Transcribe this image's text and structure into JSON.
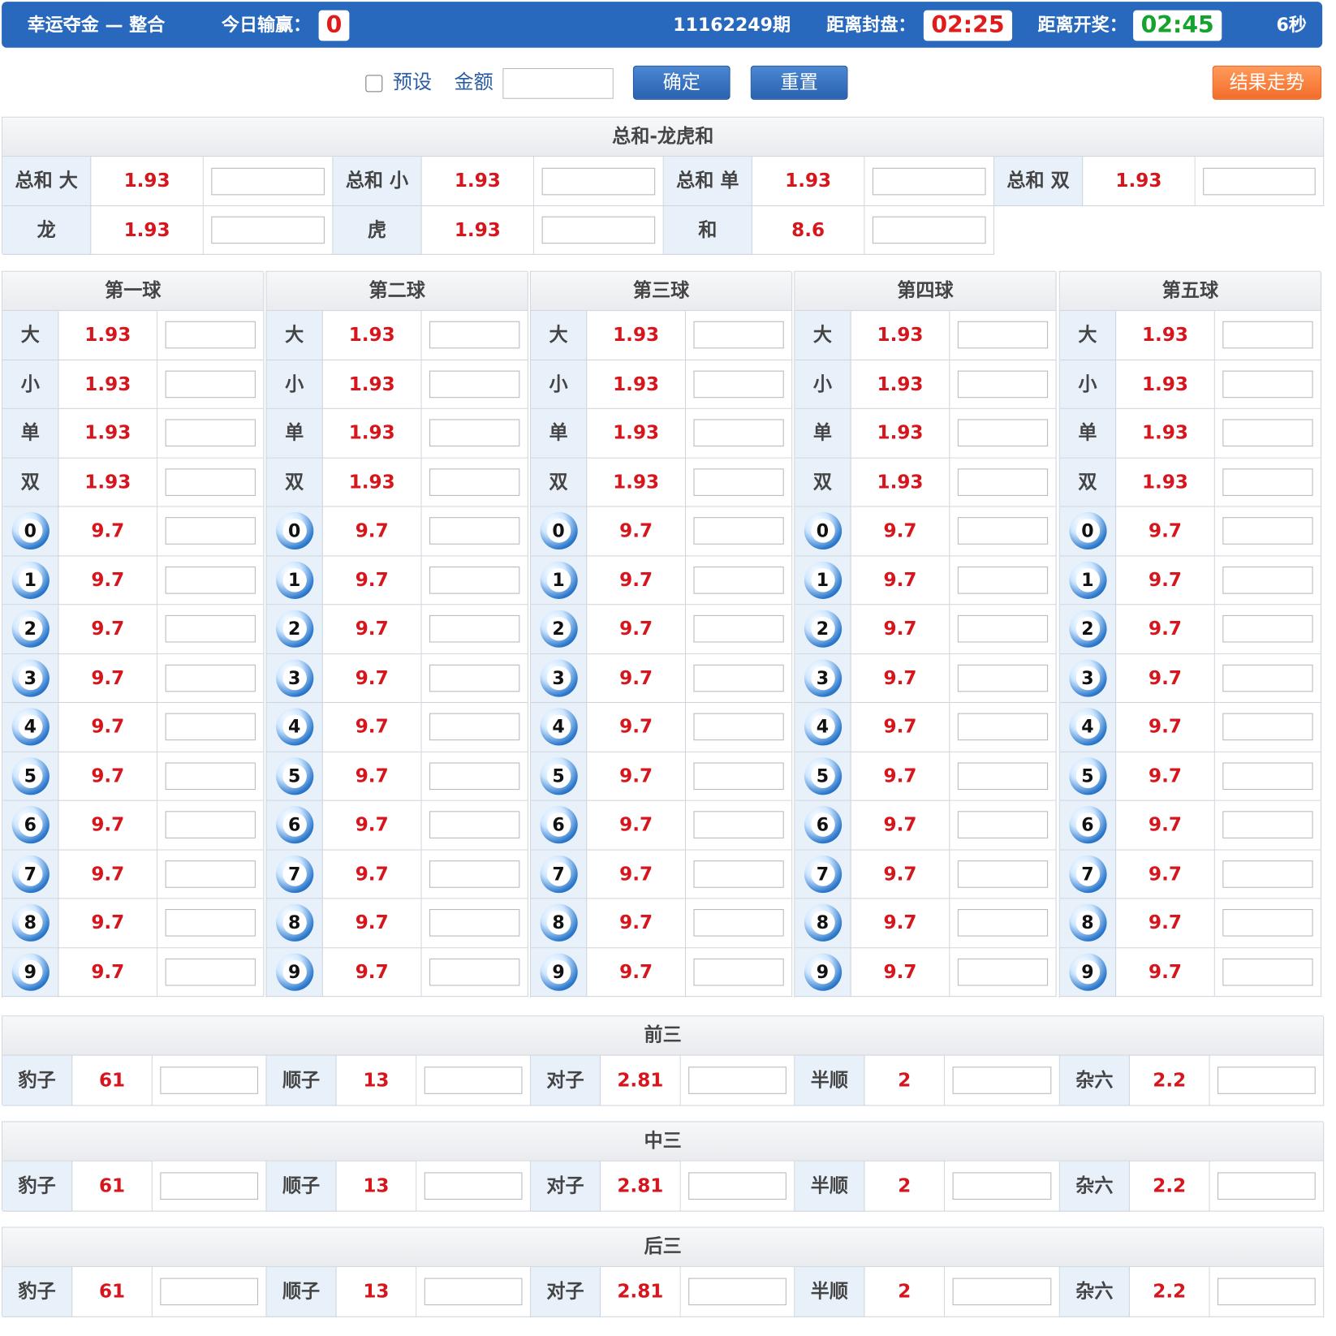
{
  "header": {
    "title": "幸运夺金 — 整合",
    "today_label": "今日输赢：",
    "today_value": "0",
    "period": "11162249期",
    "close_label": "距离封盘：",
    "close_time": "02:25",
    "draw_label": "距离开奖：",
    "draw_time": "02:45",
    "refresh": "6秒"
  },
  "controls": {
    "preset_label": "预设",
    "amount_label": "金额",
    "confirm_label": "确定",
    "reset_label": "重置",
    "trend_label": "结果走势"
  },
  "colors": {
    "header_bg": "#2868bd",
    "odds": "#d6151c",
    "close_time": "#e01b1b",
    "draw_time": "#14a32c",
    "trend_btn": "#f36d2a"
  },
  "sum_section": {
    "title": "总和-龙虎和",
    "row1": [
      {
        "name": "总和 大",
        "odds": "1.93"
      },
      {
        "name": "总和 小",
        "odds": "1.93"
      },
      {
        "name": "总和 单",
        "odds": "1.93"
      },
      {
        "name": "总和 双",
        "odds": "1.93"
      }
    ],
    "row2": [
      {
        "name": "龙",
        "odds": "1.93"
      },
      {
        "name": "虎",
        "odds": "1.93"
      },
      {
        "name": "和",
        "odds": "8.6"
      }
    ]
  },
  "balls": {
    "titles": [
      "第一球",
      "第二球",
      "第三球",
      "第四球",
      "第五球"
    ],
    "attr_rows": [
      {
        "name": "大",
        "odds": "1.93"
      },
      {
        "name": "小",
        "odds": "1.93"
      },
      {
        "name": "单",
        "odds": "1.93"
      },
      {
        "name": "双",
        "odds": "1.93"
      }
    ],
    "numbers": [
      "0",
      "1",
      "2",
      "3",
      "4",
      "5",
      "6",
      "7",
      "8",
      "9"
    ],
    "number_odds": "9.7"
  },
  "groups": [
    {
      "title": "前三",
      "items": [
        {
          "name": "豹子",
          "odds": "61"
        },
        {
          "name": "顺子",
          "odds": "13"
        },
        {
          "name": "对子",
          "odds": "2.81"
        },
        {
          "name": "半顺",
          "odds": "2"
        },
        {
          "name": "杂六",
          "odds": "2.2"
        }
      ]
    },
    {
      "title": "中三",
      "items": [
        {
          "name": "豹子",
          "odds": "61"
        },
        {
          "name": "顺子",
          "odds": "13"
        },
        {
          "name": "对子",
          "odds": "2.81"
        },
        {
          "name": "半顺",
          "odds": "2"
        },
        {
          "name": "杂六",
          "odds": "2.2"
        }
      ]
    },
    {
      "title": "后三",
      "items": [
        {
          "name": "豹子",
          "odds": "61"
        },
        {
          "name": "顺子",
          "odds": "13"
        },
        {
          "name": "对子",
          "odds": "2.81"
        },
        {
          "name": "半顺",
          "odds": "2"
        },
        {
          "name": "杂六",
          "odds": "2.2"
        }
      ]
    }
  ]
}
